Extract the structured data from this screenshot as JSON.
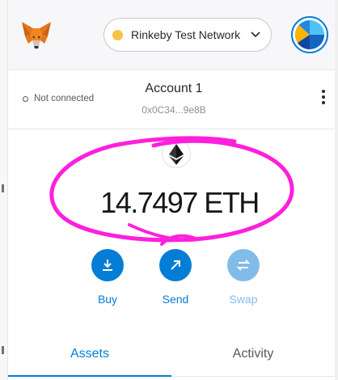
{
  "network": {
    "label": "Rinkeby Test Network",
    "dot_color": "#f6c343"
  },
  "account": {
    "connection_status": "Not connected",
    "name": "Account 1",
    "address": "0x0C34...9e8B"
  },
  "balance": {
    "amount": "14.7497",
    "currency": "ETH",
    "display": "14.7497 ETH"
  },
  "actions": [
    {
      "label": "Buy",
      "icon": "download-icon",
      "enabled": true
    },
    {
      "label": "Send",
      "icon": "arrow-up-right-icon",
      "enabled": true
    },
    {
      "label": "Swap",
      "icon": "swap-icon",
      "enabled": false
    }
  ],
  "tabs": [
    {
      "label": "Assets",
      "active": true
    },
    {
      "label": "Activity",
      "active": false
    }
  ],
  "colors": {
    "accent": "#037dd6",
    "disabled_accent": "#81bce9",
    "highlight": "#ff1fdc"
  }
}
